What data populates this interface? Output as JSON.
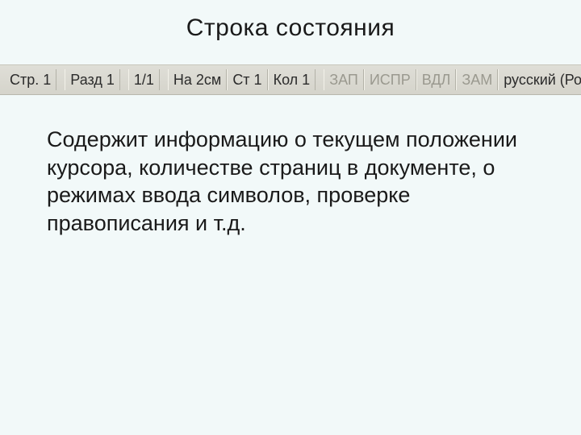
{
  "title": "Строка состояния",
  "statusbar": {
    "page": "Стр. 1",
    "section": "Разд 1",
    "pages": "1/1",
    "at": "На 2см",
    "line": "Ст 1",
    "col": "Кол 1",
    "rec": "ЗАП",
    "trk": "ИСПР",
    "ext": "ВДЛ",
    "ovr": "ЗАМ",
    "lang": "русский (Ро"
  },
  "body": "Содержит информацию  о текущем положении курсора, количестве страниц в документе, о режимах ввода символов, проверке правописания и т.д."
}
